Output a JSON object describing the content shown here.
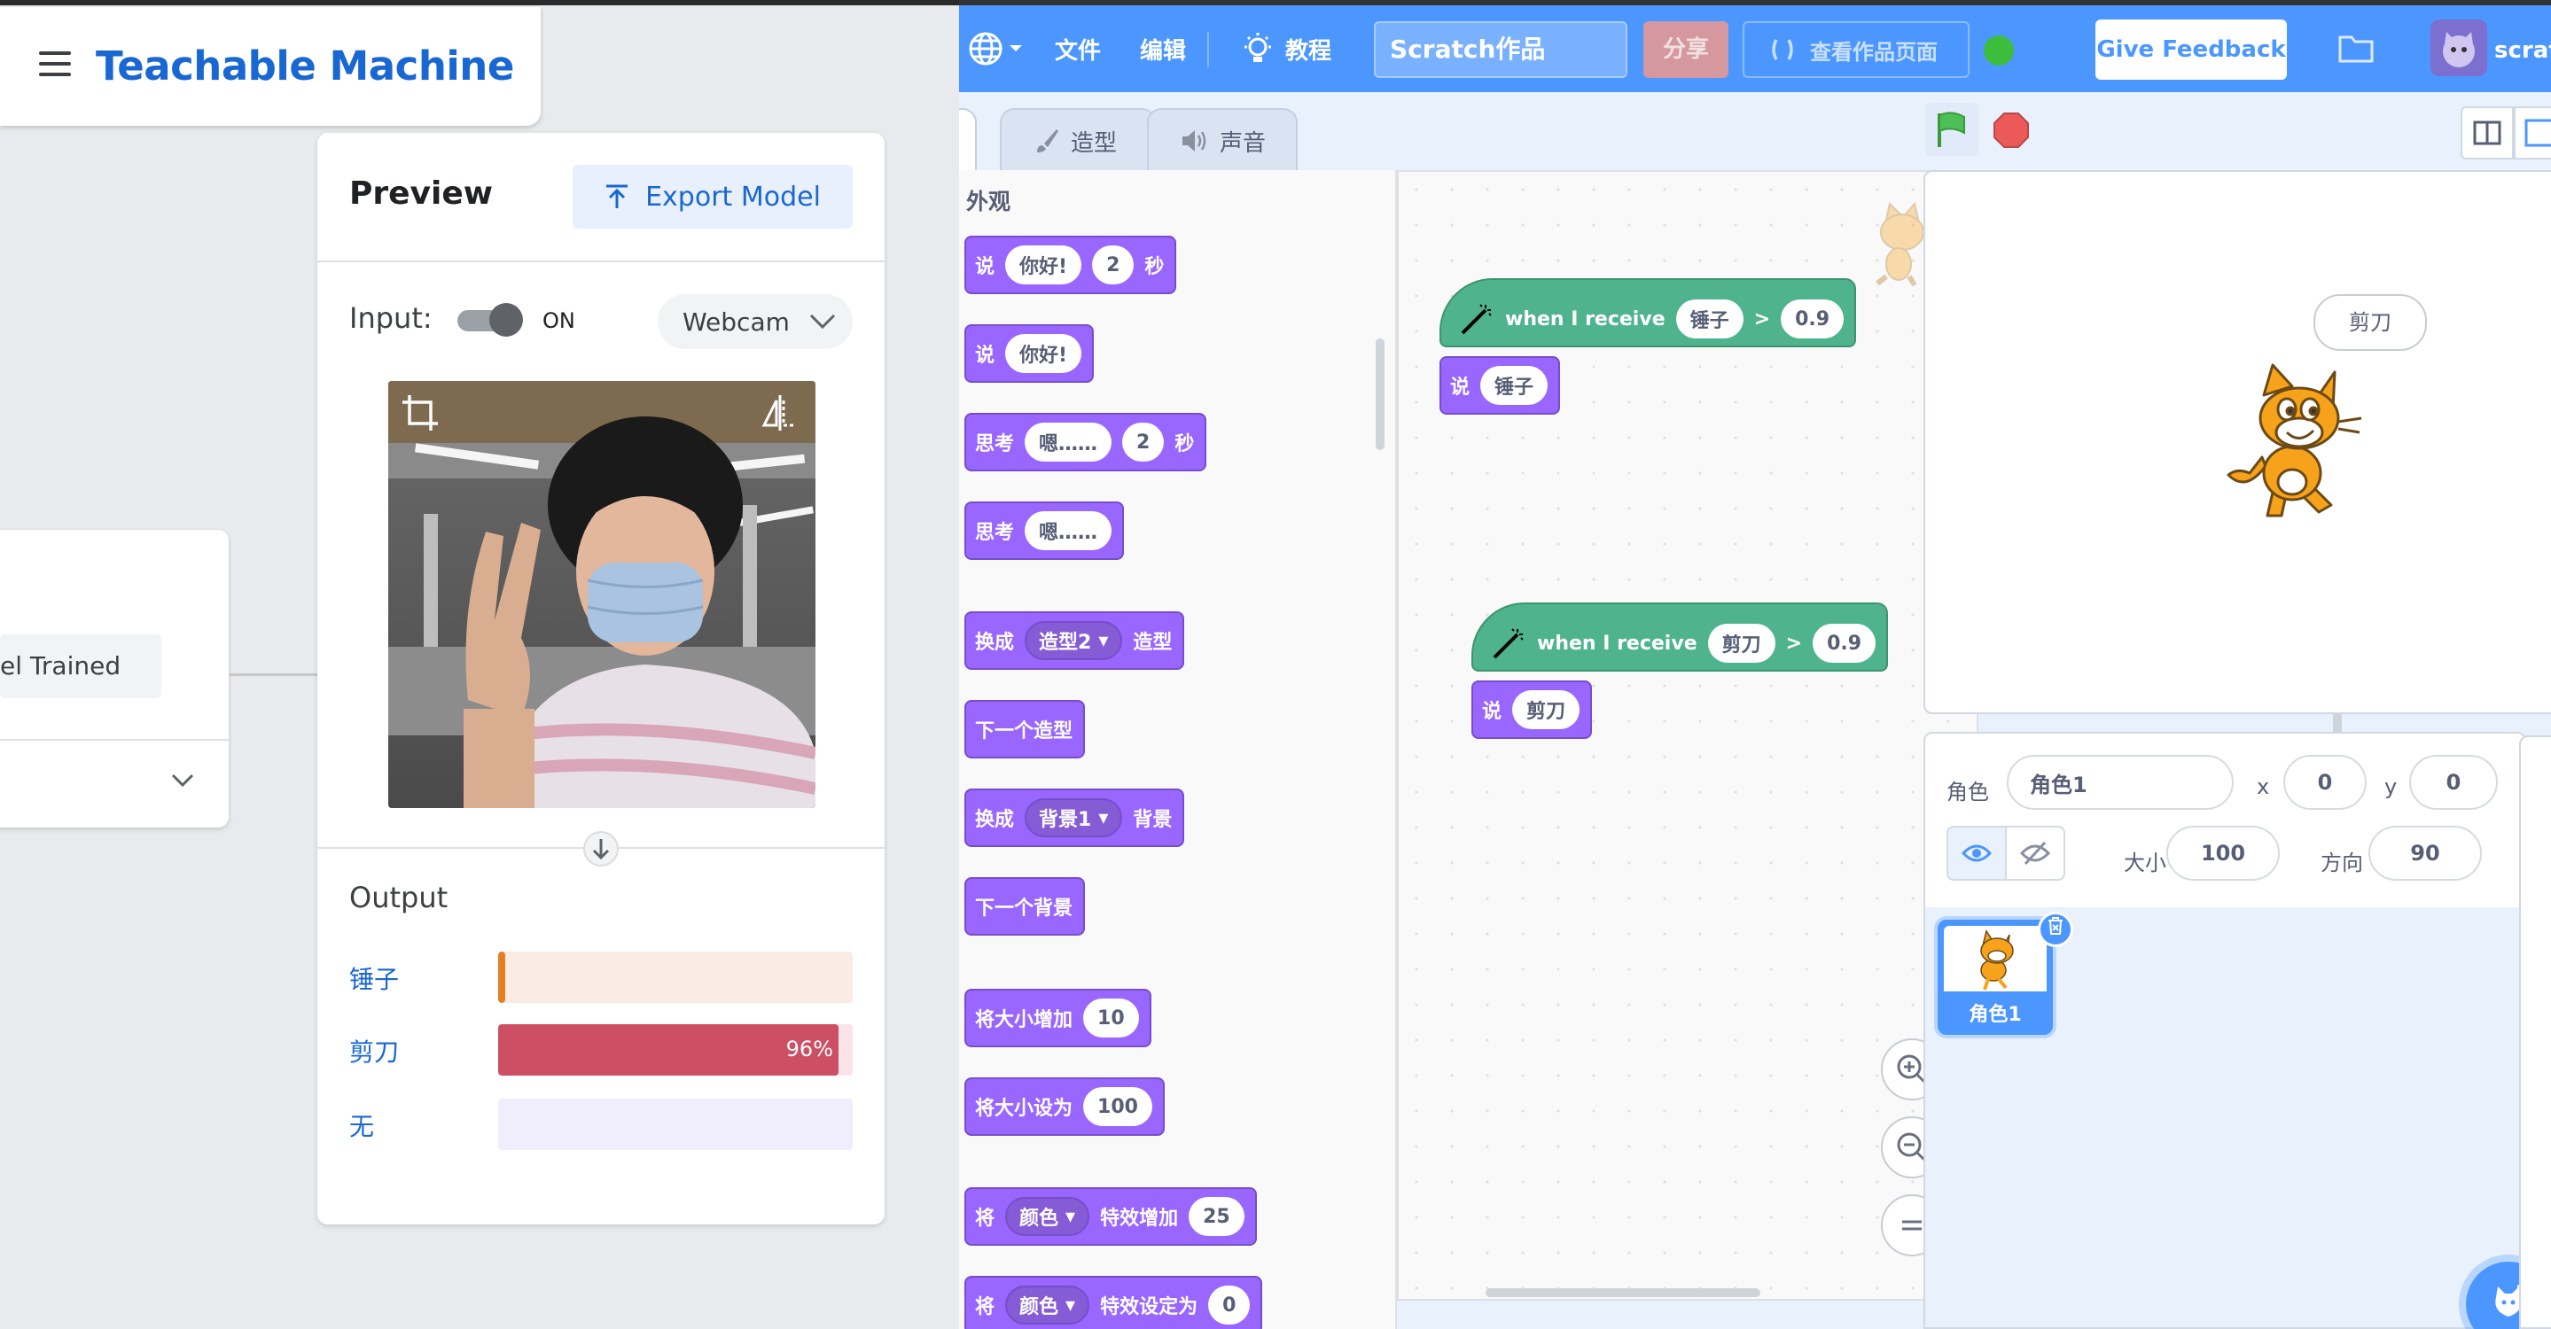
{
  "tm": {
    "app_title": "Teachable Machine",
    "train_button_label": "el Trained",
    "preview": {
      "title": "Preview",
      "export_label": "Export Model",
      "input_label": "Input:",
      "toggle_label": "ON",
      "toggle_on": true,
      "source_select": "Webcam",
      "output_label": "Output",
      "classes": [
        {
          "label": "锤子",
          "confidence": 0.02,
          "color": "#e67e22",
          "track": "#fbece3",
          "pct_text": ""
        },
        {
          "label": "剪刀",
          "confidence": 0.96,
          "color": "#cd4f64",
          "track": "#fbe4e7",
          "pct_text": "96%"
        },
        {
          "label": "无",
          "confidence": 0.0,
          "color": "#6c5ce7",
          "track": "#f0eefc",
          "pct_text": ""
        }
      ]
    }
  },
  "scratch": {
    "menu": {
      "file": "文件",
      "edit": "编辑",
      "tutorials": "教程",
      "project_title": "Scratch作品",
      "share": "分享",
      "see_project_page": "查看作品页面",
      "give_feedback": "Give Feedback",
      "username": "scratch"
    },
    "tabs": {
      "costumes": "造型",
      "sounds": "声音"
    },
    "palette": {
      "category": "外观",
      "blocks": [
        {
          "parts": [
            "说",
            "[你好!]",
            "[2]",
            "秒"
          ]
        },
        {
          "parts": [
            "说",
            "[你好!]"
          ]
        },
        {
          "parts": [
            "思考",
            "[嗯……]",
            "[2]",
            "秒"
          ]
        },
        {
          "parts": [
            "思考",
            "[嗯……]"
          ]
        },
        {
          "parts": [
            "换成",
            "{造型2}",
            "造型"
          ]
        },
        {
          "parts": [
            "下一个造型"
          ]
        },
        {
          "parts": [
            "换成",
            "{背景1}",
            "背景"
          ]
        },
        {
          "parts": [
            "下一个背景"
          ]
        },
        {
          "parts": [
            "将大小增加",
            "[10]"
          ]
        },
        {
          "parts": [
            "将大小设为",
            "[100]"
          ]
        },
        {
          "parts": [
            "将",
            "{颜色}",
            "特效增加",
            "[25]"
          ]
        },
        {
          "parts": [
            "将",
            "{颜色}",
            "特效设定为",
            "[0]"
          ]
        }
      ]
    },
    "scripts": [
      {
        "hat": "when I receive",
        "class": "锤子",
        "op": ">",
        "threshold": "0.9",
        "say_label": "说",
        "say": "锤子"
      },
      {
        "hat": "when I receive",
        "class": "剪刀",
        "op": ">",
        "threshold": "0.9",
        "say_label": "说",
        "say": "剪刀"
      }
    ],
    "stage": {
      "speech_bubble": "剪刀"
    },
    "sprite_info": {
      "sprite_label": "角色",
      "sprite_name": "角色1",
      "x_label": "x",
      "x": "0",
      "y_label": "y",
      "y": "0",
      "size_label": "大小",
      "size": "100",
      "direction_label": "方向",
      "direction": "90"
    },
    "sprites": [
      {
        "name": "角色1"
      }
    ]
  }
}
